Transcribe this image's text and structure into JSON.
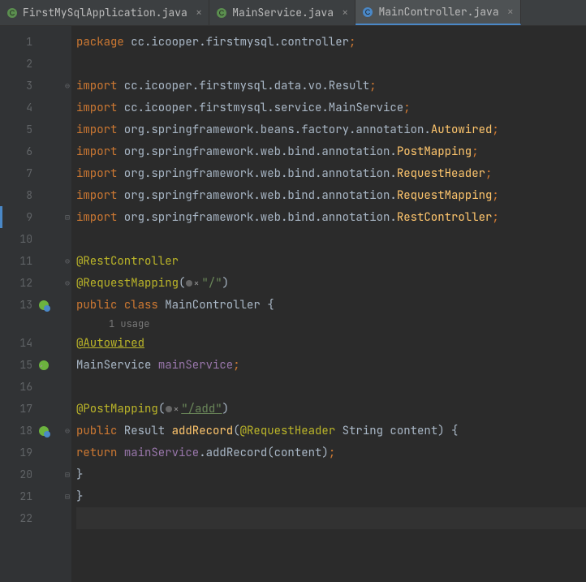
{
  "tabs": [
    {
      "label": "FirstMySqlApplication.java",
      "active": false
    },
    {
      "label": "MainService.java",
      "active": false
    },
    {
      "label": "MainController.java",
      "active": true
    }
  ],
  "lines": {
    "l1": "1",
    "l2": "2",
    "l3": "3",
    "l4": "4",
    "l5": "5",
    "l6": "6",
    "l7": "7",
    "l8": "8",
    "l9": "9",
    "l10": "10",
    "l11": "11",
    "l12": "12",
    "l13": "13",
    "l14": "14",
    "l15": "15",
    "l16": "16",
    "l17": "17",
    "l18": "18",
    "l19": "19",
    "l20": "20",
    "l21": "21",
    "l22": "22"
  },
  "code": {
    "package_kw": "package",
    "package_path": " cc.icooper.firstmysql.controller",
    "import_kw": "import",
    "imp1": " cc.icooper.firstmysql.data.vo.Result",
    "imp2": " cc.icooper.firstmysql.service.MainService",
    "imp3": " org.springframework.beans.factory.annotation.",
    "imp3b": "Autowired",
    "imp4": " org.springframework.web.bind.annotation.",
    "imp4b": "PostMapping",
    "imp5b": "RequestHeader",
    "imp6b": "RequestMapping",
    "imp7b": "RestController",
    "ann_rest": "@RestController",
    "ann_reqmap": "@RequestMapping",
    "str_root": "\"/\"",
    "public_kw": "public",
    "class_kw": "class",
    "cls_name": " MainController ",
    "usage": "1 usage",
    "ann_autowired": "@Autowired",
    "svc_type": "MainService ",
    "svc_field": "mainService",
    "ann_post": "@PostMapping",
    "str_add": "\"/add\"",
    "ret_type": " Result ",
    "method_name": "addRecord",
    "ann_reqhdr": "@RequestHeader",
    "param": " String content",
    "return_kw": "return",
    "call": ".addRecord(content)",
    "semi": ";",
    "lparen": "(",
    "rparen": ")",
    "lbrace": "{",
    "rbrace": "}",
    "sp": " "
  }
}
